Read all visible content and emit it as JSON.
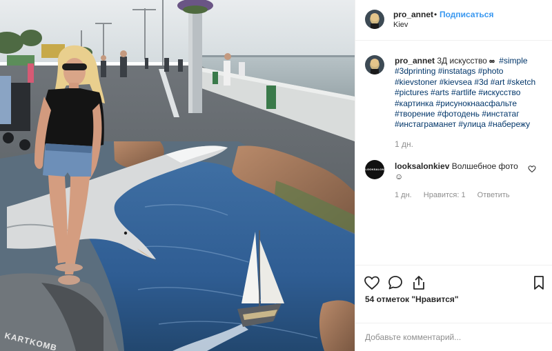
{
  "post": {
    "username": "pro_annet",
    "follow_label": "Подписаться",
    "separator": "•",
    "location": "Kiev",
    "caption_prefix": "3Д искусство",
    "caption_hashtags": "#simple #3dprinting #instatags #photo #kievstoner #kievsea #3d #art #sketch #pictures #arts #artlife #искусство #картинка #рисунокнаасфальте #творение #фотодень #инстатаг #инстаграманет #улица #набережу",
    "caption_time": "1 дн.",
    "likes": "54 отметок \"Нравится\"",
    "photo_signature": "KARTKOMB"
  },
  "comment": {
    "username": "looksalonkiev",
    "text": "Волшебное фото",
    "emoji": "☺",
    "avatar_text": "LOOKSALON",
    "time": "1 дн.",
    "likes": "Нравится: 1",
    "reply_label": "Ответить"
  },
  "input": {
    "placeholder": "Добавьте комментарий..."
  },
  "icons": {
    "like": "heart-icon",
    "comment": "comment-bubble-icon",
    "share": "share-icon",
    "save": "bookmark-icon",
    "comment_like": "small-heart-icon"
  },
  "colors": {
    "link": "#3897f0",
    "hashtag": "#003569",
    "muted": "#8e8e8e",
    "border": "#efefef"
  }
}
